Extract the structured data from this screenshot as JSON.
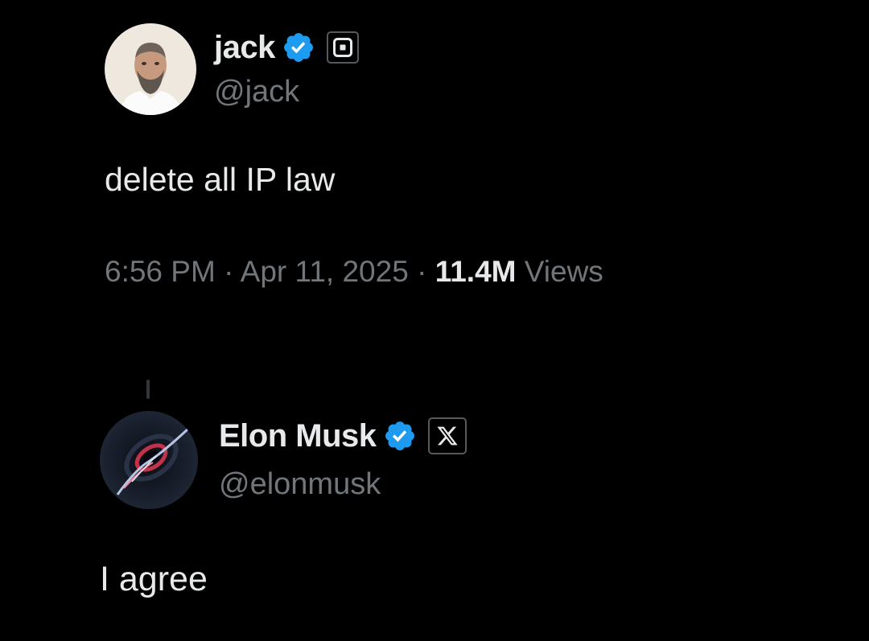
{
  "tweets": [
    {
      "author": {
        "display_name": "jack",
        "handle": "@jack",
        "verified": true,
        "affiliation_icon": "square-logo-icon"
      },
      "text": "delete all IP law",
      "time": "6:56 PM",
      "date": "Apr 11, 2025",
      "separator": "·",
      "views_count": "11.4M",
      "views_label": "Views"
    },
    {
      "author": {
        "display_name": "Elon Musk",
        "handle": "@elonmusk",
        "verified": true,
        "affiliation_icon": "x-logo-icon"
      },
      "text": "I agree"
    }
  ],
  "colors": {
    "background": "#000000",
    "primary_text": "#e7e9ea",
    "secondary_text": "#71767b",
    "verified_blue": "#1d9bf0"
  }
}
